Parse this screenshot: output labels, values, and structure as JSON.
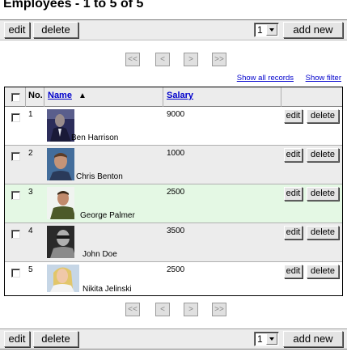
{
  "page_title": "Employees - 1 to 5 of 5",
  "toolbar": {
    "edit_label": "edit",
    "delete_label": "delete",
    "page_select_value": "1",
    "add_new_label": "add new"
  },
  "pager": {
    "first_label": "<<",
    "prev_label": "<",
    "next_label": ">",
    "last_label": ">>"
  },
  "links": {
    "show_all": "Show all records",
    "show_filter": "Show filter"
  },
  "table": {
    "columns": {
      "no": "No.",
      "name": "Name",
      "sort_indicator": "▲",
      "salary": "Salary"
    },
    "row_edit_label": "edit",
    "row_delete_label": "delete",
    "rows": [
      {
        "no": "1",
        "name": "Ben Harrison",
        "salary": "9000",
        "highlight": false
      },
      {
        "no": "2",
        "name": "Chris Benton",
        "salary": "1000",
        "highlight": false
      },
      {
        "no": "3",
        "name": "George Palmer",
        "salary": "2500",
        "highlight": true
      },
      {
        "no": "4",
        "name": "John Doe",
        "salary": "3500",
        "highlight": false
      },
      {
        "no": "5",
        "name": "Nikita Jelinski",
        "salary": "2500",
        "highlight": false
      }
    ]
  },
  "colors": {
    "link": "#0000cc",
    "row_odd": "#ffffff",
    "row_even": "#ececec",
    "row_highlight": "#e4f8e4"
  }
}
